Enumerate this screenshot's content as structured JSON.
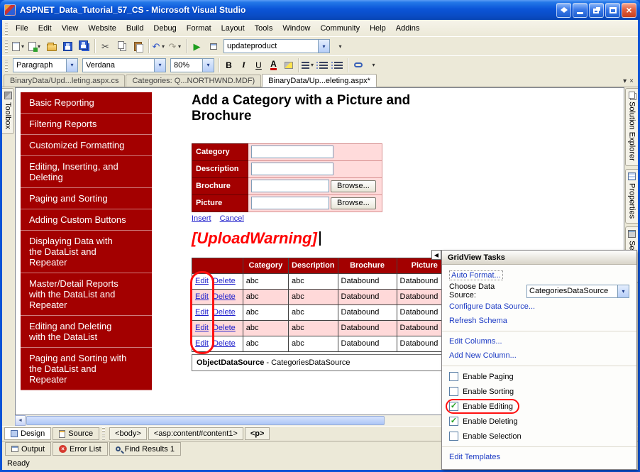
{
  "window": {
    "title": "ASPNET_Data_Tutorial_57_CS - Microsoft Visual Studio"
  },
  "menu": {
    "items": [
      "File",
      "Edit",
      "View",
      "Website",
      "Build",
      "Debug",
      "Format",
      "Layout",
      "Tools",
      "Window",
      "Community",
      "Help",
      "Addins"
    ]
  },
  "toolbar": {
    "combo_value": "updateproduct"
  },
  "format_bar": {
    "style_combo": "Paragraph",
    "font_combo": "Verdana",
    "size_combo": "80%",
    "bold": "B",
    "italic": "I",
    "underline": "U",
    "color_a": "A"
  },
  "doc_tabs": {
    "tabs": [
      "BinaryData/Upd...leting.aspx.cs",
      "Categories: Q...NORTHWND.MDF)",
      "BinaryData/Up...eleting.aspx*"
    ]
  },
  "left_strip": {
    "toolbox": "Toolbox"
  },
  "right_strip": {
    "tabs": [
      "Solution Explorer",
      "Properties",
      "Server E..."
    ]
  },
  "design": {
    "sidebar_items": [
      "Basic Reporting",
      "Filtering Reports",
      "Customized Formatting",
      "Editing, Inserting, and Deleting",
      "Paging and Sorting",
      "Adding Custom Buttons",
      "Displaying Data with the DataList and Repeater",
      "Master/Detail Reports with the DataList and Repeater",
      "Editing and Deleting with the DataList",
      "Paging and Sorting with the DataList and Repeater"
    ],
    "heading": "Add a Category with a Picture and Brochure",
    "form": {
      "rows": [
        {
          "label": "Category"
        },
        {
          "label": "Description"
        },
        {
          "label": "Brochure"
        },
        {
          "label": "Picture"
        }
      ],
      "browse_label": "Browse...",
      "insert_link": "Insert",
      "cancel_link": "Cancel"
    },
    "upload_warning": "[UploadWarning]",
    "grid": {
      "headers": [
        "",
        "Category",
        "Description",
        "Brochure",
        "Picture"
      ],
      "rows": [
        {
          "edit": "Edit",
          "del": "Delete",
          "category": "abc",
          "description": "abc",
          "brochure": "Databound",
          "picture": "Databound"
        },
        {
          "edit": "Edit",
          "del": "Delete",
          "category": "abc",
          "description": "abc",
          "brochure": "Databound",
          "picture": "Databound"
        },
        {
          "edit": "Edit",
          "del": "Delete",
          "category": "abc",
          "description": "abc",
          "brochure": "Databound",
          "picture": "Databound"
        },
        {
          "edit": "Edit",
          "del": "Delete",
          "category": "abc",
          "description": "abc",
          "brochure": "Databound",
          "picture": "Databound"
        },
        {
          "edit": "Edit",
          "del": "Delete",
          "category": "abc",
          "description": "abc",
          "brochure": "Databound",
          "picture": "Databound"
        }
      ],
      "footer_bold": "ObjectDataSource",
      "footer_rest": " - CategoriesDataSource"
    }
  },
  "tasks_panel": {
    "title": "GridView Tasks",
    "auto_format": "Auto Format...",
    "choose_data_source_label": "Choose Data Source:",
    "data_source_value": "CategoriesDataSource",
    "configure_link": "Configure Data Source...",
    "refresh_link": "Refresh Schema",
    "edit_columns_link": "Edit Columns...",
    "add_column_link": "Add New Column...",
    "checkboxes": [
      {
        "label": "Enable Paging",
        "checked": false
      },
      {
        "label": "Enable Sorting",
        "checked": false
      },
      {
        "label": "Enable Editing",
        "checked": true
      },
      {
        "label": "Enable Deleting",
        "checked": true
      },
      {
        "label": "Enable Selection",
        "checked": false
      }
    ],
    "edit_templates_link": "Edit Templates"
  },
  "bottom_bar": {
    "design_button": "Design",
    "source_button": "Source",
    "tag_path": [
      "<body>",
      "<asp:content#content1>",
      "<p>"
    ],
    "panel_tabs": [
      "Output",
      "Error List",
      "Find Results 1"
    ],
    "status": "Ready"
  },
  "colors": {
    "maroon": "#A30000",
    "pink": "#FFD9D9",
    "annotation_red": "#FF1010",
    "titlebar_blue": "#0A51D0"
  },
  "icons": {
    "check": "✓",
    "close": "×",
    "dropdown": "▾",
    "play": "▶",
    "cut": "✂",
    "undo": "↶",
    "redo": "↷",
    "collapse_arrow": "◀",
    "left_arrow": "◄",
    "right_arrow": "►",
    "error_x": "×"
  }
}
